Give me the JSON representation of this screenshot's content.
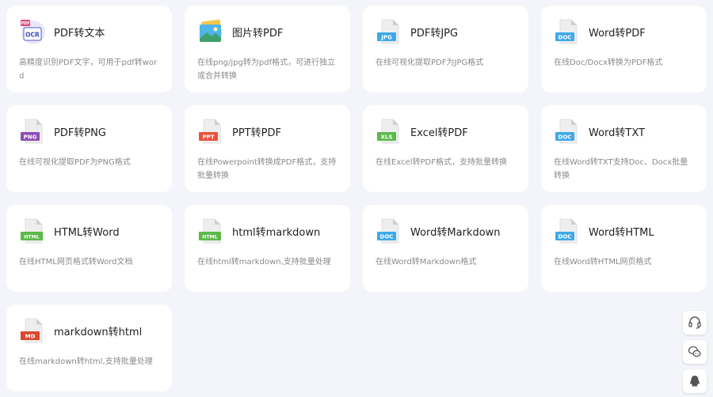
{
  "cards": [
    {
      "title": "PDF转文本",
      "desc": "高精度识别PDF文字，可用于pdf转word",
      "icon": "ocr",
      "tag": "OCR"
    },
    {
      "title": "图片转PDF",
      "desc": "在线png/jpg转为pdf格式，可进行独立或合并转换",
      "icon": "image",
      "tag": ""
    },
    {
      "title": "PDF转JPG",
      "desc": "在线可视化提取PDF为JPG格式",
      "icon": "file",
      "tag": "JPG",
      "color": "#3fa9e8"
    },
    {
      "title": "Word转PDF",
      "desc": "在线Doc/Docx转换为PDF格式",
      "icon": "file",
      "tag": "DOC",
      "color": "#3fa9e8"
    },
    {
      "title": "PDF转PNG",
      "desc": "在线可视化提取PDF为PNG格式",
      "icon": "file",
      "tag": "PNG",
      "color": "#8e4fb5"
    },
    {
      "title": "PPT转PDF",
      "desc": "在线Powerpoint转换成PDF格式，支持批量转换",
      "icon": "file",
      "tag": "PPT",
      "color": "#e8533a"
    },
    {
      "title": "Excel转PDF",
      "desc": "在线Excel转PDF格式，支持批量转换",
      "icon": "file",
      "tag": "XLS",
      "color": "#5bb94a"
    },
    {
      "title": "Word转TXT",
      "desc": "在线Word转TXT支持Doc、Docx批量转换",
      "icon": "file",
      "tag": "DOC",
      "color": "#3fa9e8"
    },
    {
      "title": "HTML转Word",
      "desc": "在线HTML网页格式转Word文档",
      "icon": "file",
      "tag": "HTML",
      "color": "#5bb94a"
    },
    {
      "title": "html转markdown",
      "desc": "在线html转markdown,支持批量处理",
      "icon": "file",
      "tag": "HTML",
      "color": "#5bb94a"
    },
    {
      "title": "Word转Markdown",
      "desc": "在线Word转Markdown格式",
      "icon": "file",
      "tag": "DOC",
      "color": "#3fa9e8"
    },
    {
      "title": "Word转HTML",
      "desc": "在线Word转HTML网页格式",
      "icon": "file",
      "tag": "DOC",
      "color": "#3fa9e8"
    },
    {
      "title": "markdown转html",
      "desc": "在线markdown转html,支持批量处理",
      "icon": "file",
      "tag": "MD",
      "color": "#d9492f"
    }
  ],
  "side_buttons": [
    {
      "name": "headset-icon"
    },
    {
      "name": "wechat-icon"
    },
    {
      "name": "qq-icon"
    }
  ]
}
